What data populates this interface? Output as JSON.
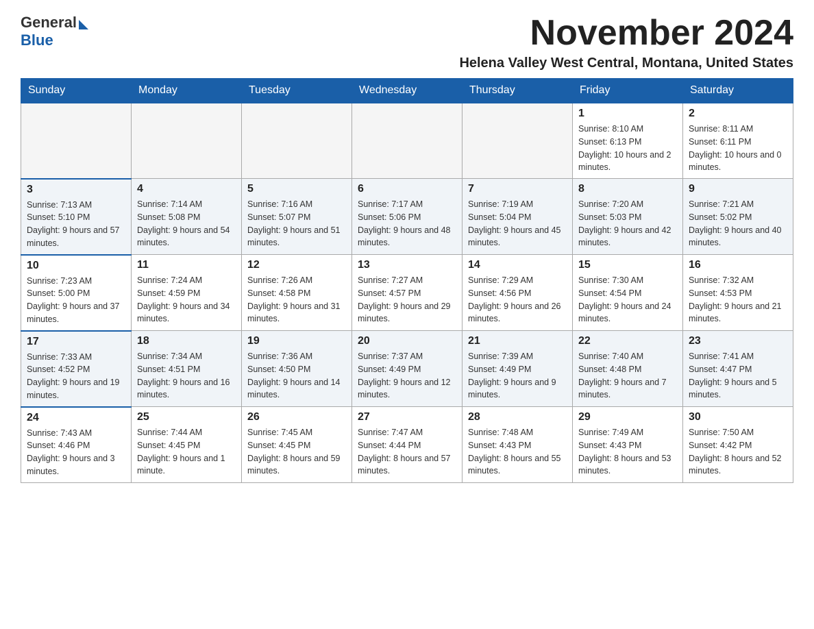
{
  "header": {
    "logo_general": "General",
    "logo_blue": "Blue",
    "month_title": "November 2024",
    "location": "Helena Valley West Central, Montana, United States"
  },
  "days_of_week": [
    "Sunday",
    "Monday",
    "Tuesday",
    "Wednesday",
    "Thursday",
    "Friday",
    "Saturday"
  ],
  "weeks": [
    [
      {
        "day": "",
        "sunrise": "",
        "sunset": "",
        "daylight": ""
      },
      {
        "day": "",
        "sunrise": "",
        "sunset": "",
        "daylight": ""
      },
      {
        "day": "",
        "sunrise": "",
        "sunset": "",
        "daylight": ""
      },
      {
        "day": "",
        "sunrise": "",
        "sunset": "",
        "daylight": ""
      },
      {
        "day": "",
        "sunrise": "",
        "sunset": "",
        "daylight": ""
      },
      {
        "day": "1",
        "sunrise": "Sunrise: 8:10 AM",
        "sunset": "Sunset: 6:13 PM",
        "daylight": "Daylight: 10 hours and 2 minutes."
      },
      {
        "day": "2",
        "sunrise": "Sunrise: 8:11 AM",
        "sunset": "Sunset: 6:11 PM",
        "daylight": "Daylight: 10 hours and 0 minutes."
      }
    ],
    [
      {
        "day": "3",
        "sunrise": "Sunrise: 7:13 AM",
        "sunset": "Sunset: 5:10 PM",
        "daylight": "Daylight: 9 hours and 57 minutes."
      },
      {
        "day": "4",
        "sunrise": "Sunrise: 7:14 AM",
        "sunset": "Sunset: 5:08 PM",
        "daylight": "Daylight: 9 hours and 54 minutes."
      },
      {
        "day": "5",
        "sunrise": "Sunrise: 7:16 AM",
        "sunset": "Sunset: 5:07 PM",
        "daylight": "Daylight: 9 hours and 51 minutes."
      },
      {
        "day": "6",
        "sunrise": "Sunrise: 7:17 AM",
        "sunset": "Sunset: 5:06 PM",
        "daylight": "Daylight: 9 hours and 48 minutes."
      },
      {
        "day": "7",
        "sunrise": "Sunrise: 7:19 AM",
        "sunset": "Sunset: 5:04 PM",
        "daylight": "Daylight: 9 hours and 45 minutes."
      },
      {
        "day": "8",
        "sunrise": "Sunrise: 7:20 AM",
        "sunset": "Sunset: 5:03 PM",
        "daylight": "Daylight: 9 hours and 42 minutes."
      },
      {
        "day": "9",
        "sunrise": "Sunrise: 7:21 AM",
        "sunset": "Sunset: 5:02 PM",
        "daylight": "Daylight: 9 hours and 40 minutes."
      }
    ],
    [
      {
        "day": "10",
        "sunrise": "Sunrise: 7:23 AM",
        "sunset": "Sunset: 5:00 PM",
        "daylight": "Daylight: 9 hours and 37 minutes."
      },
      {
        "day": "11",
        "sunrise": "Sunrise: 7:24 AM",
        "sunset": "Sunset: 4:59 PM",
        "daylight": "Daylight: 9 hours and 34 minutes."
      },
      {
        "day": "12",
        "sunrise": "Sunrise: 7:26 AM",
        "sunset": "Sunset: 4:58 PM",
        "daylight": "Daylight: 9 hours and 31 minutes."
      },
      {
        "day": "13",
        "sunrise": "Sunrise: 7:27 AM",
        "sunset": "Sunset: 4:57 PM",
        "daylight": "Daylight: 9 hours and 29 minutes."
      },
      {
        "day": "14",
        "sunrise": "Sunrise: 7:29 AM",
        "sunset": "Sunset: 4:56 PM",
        "daylight": "Daylight: 9 hours and 26 minutes."
      },
      {
        "day": "15",
        "sunrise": "Sunrise: 7:30 AM",
        "sunset": "Sunset: 4:54 PM",
        "daylight": "Daylight: 9 hours and 24 minutes."
      },
      {
        "day": "16",
        "sunrise": "Sunrise: 7:32 AM",
        "sunset": "Sunset: 4:53 PM",
        "daylight": "Daylight: 9 hours and 21 minutes."
      }
    ],
    [
      {
        "day": "17",
        "sunrise": "Sunrise: 7:33 AM",
        "sunset": "Sunset: 4:52 PM",
        "daylight": "Daylight: 9 hours and 19 minutes."
      },
      {
        "day": "18",
        "sunrise": "Sunrise: 7:34 AM",
        "sunset": "Sunset: 4:51 PM",
        "daylight": "Daylight: 9 hours and 16 minutes."
      },
      {
        "day": "19",
        "sunrise": "Sunrise: 7:36 AM",
        "sunset": "Sunset: 4:50 PM",
        "daylight": "Daylight: 9 hours and 14 minutes."
      },
      {
        "day": "20",
        "sunrise": "Sunrise: 7:37 AM",
        "sunset": "Sunset: 4:49 PM",
        "daylight": "Daylight: 9 hours and 12 minutes."
      },
      {
        "day": "21",
        "sunrise": "Sunrise: 7:39 AM",
        "sunset": "Sunset: 4:49 PM",
        "daylight": "Daylight: 9 hours and 9 minutes."
      },
      {
        "day": "22",
        "sunrise": "Sunrise: 7:40 AM",
        "sunset": "Sunset: 4:48 PM",
        "daylight": "Daylight: 9 hours and 7 minutes."
      },
      {
        "day": "23",
        "sunrise": "Sunrise: 7:41 AM",
        "sunset": "Sunset: 4:47 PM",
        "daylight": "Daylight: 9 hours and 5 minutes."
      }
    ],
    [
      {
        "day": "24",
        "sunrise": "Sunrise: 7:43 AM",
        "sunset": "Sunset: 4:46 PM",
        "daylight": "Daylight: 9 hours and 3 minutes."
      },
      {
        "day": "25",
        "sunrise": "Sunrise: 7:44 AM",
        "sunset": "Sunset: 4:45 PM",
        "daylight": "Daylight: 9 hours and 1 minute."
      },
      {
        "day": "26",
        "sunrise": "Sunrise: 7:45 AM",
        "sunset": "Sunset: 4:45 PM",
        "daylight": "Daylight: 8 hours and 59 minutes."
      },
      {
        "day": "27",
        "sunrise": "Sunrise: 7:47 AM",
        "sunset": "Sunset: 4:44 PM",
        "daylight": "Daylight: 8 hours and 57 minutes."
      },
      {
        "day": "28",
        "sunrise": "Sunrise: 7:48 AM",
        "sunset": "Sunset: 4:43 PM",
        "daylight": "Daylight: 8 hours and 55 minutes."
      },
      {
        "day": "29",
        "sunrise": "Sunrise: 7:49 AM",
        "sunset": "Sunset: 4:43 PM",
        "daylight": "Daylight: 8 hours and 53 minutes."
      },
      {
        "day": "30",
        "sunrise": "Sunrise: 7:50 AM",
        "sunset": "Sunset: 4:42 PM",
        "daylight": "Daylight: 8 hours and 52 minutes."
      }
    ]
  ]
}
